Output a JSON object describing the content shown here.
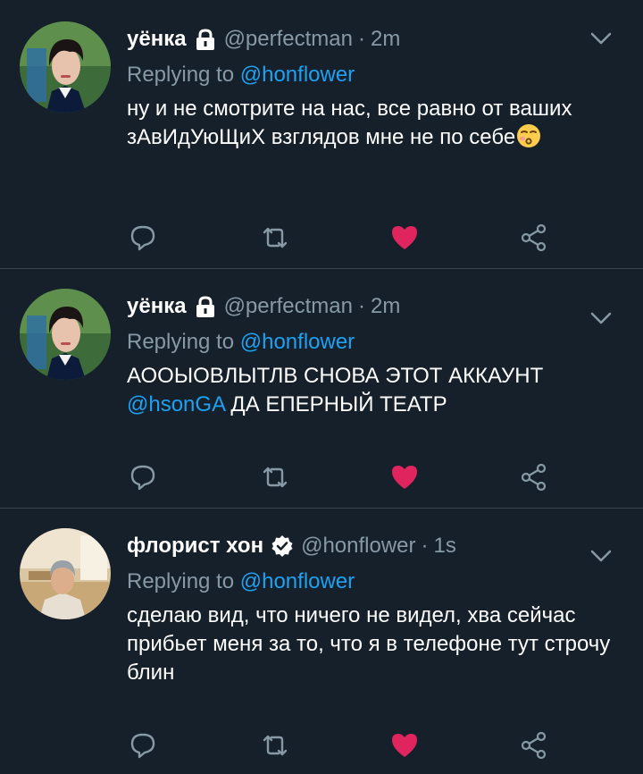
{
  "tweets": [
    {
      "display_name": "уёнка",
      "badge": "lock-icon",
      "handle": "@perfectman",
      "separator": "·",
      "time": "2m",
      "replying_prefix": "Replying to ",
      "replying_to": "@honflower",
      "text_before": "ну и не смотрите на нас, все равно от ваших зАвИдУюЩиХ взглядов мне не по себе",
      "mention_inline": "",
      "text_after": "",
      "emoji": "kissing-face-icon",
      "liked": true
    },
    {
      "display_name": "уёнка",
      "badge": "lock-icon",
      "handle": "@perfectman",
      "separator": "·",
      "time": "2m",
      "replying_prefix": "Replying to ",
      "replying_to": "@honflower",
      "text_before": "АООЫОВЛЫТЛВ СНОВА ЭТОТ АККАУНТ ",
      "mention_inline": "@hsonGA",
      "text_after": " ДА ЕПЕРНЫЙ ТЕАТР",
      "emoji": "",
      "liked": true
    },
    {
      "display_name": "флорист хон",
      "badge": "verified-icon",
      "handle": "@honflower",
      "separator": "·",
      "time": "1s",
      "replying_prefix": "Replying to ",
      "replying_to": "@honflower",
      "text_before": "сделаю вид, что ничего не видел, хва сейчас прибьет меня за то, что я в телефоне тут строчу блин",
      "mention_inline": "",
      "text_after": "",
      "emoji": "",
      "liked": true
    }
  ],
  "colors": {
    "background": "#15202b",
    "muted": "#8899a6",
    "accent": "#1da1f2",
    "like": "#e0245e",
    "divider": "#38444d"
  },
  "icons": [
    "reply-icon",
    "retweet-icon",
    "heart-icon",
    "share-icon",
    "chevron-down-icon"
  ]
}
